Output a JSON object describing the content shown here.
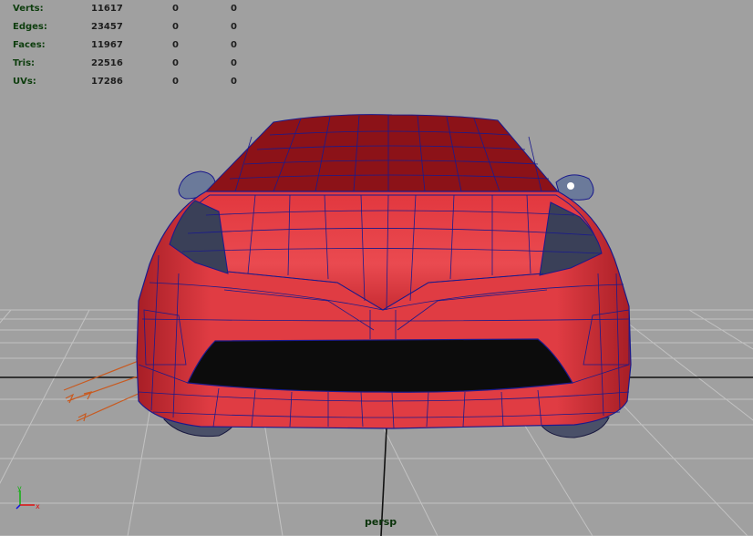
{
  "viewport": {
    "camera_label": "persp",
    "background_color": "#a0a0a0",
    "grid_color": "#c8c8c8",
    "axis_color": "#000000"
  },
  "heads_up_display": {
    "rows": [
      {
        "label": "Verts:",
        "values": [
          "11617",
          "0",
          "0"
        ]
      },
      {
        "label": "Edges:",
        "values": [
          "23457",
          "0",
          "0"
        ]
      },
      {
        "label": "Faces:",
        "values": [
          "11967",
          "0",
          "0"
        ]
      },
      {
        "label": "Tris:",
        "values": [
          "22516",
          "0",
          "0"
        ]
      },
      {
        "label": "UVs:",
        "values": [
          "17286",
          "0",
          "0"
        ]
      }
    ]
  },
  "axis_gizmo": {
    "labels": [
      "y",
      "x"
    ],
    "colors": {
      "x": "#e01010",
      "y": "#10b010",
      "z": "#1010e0"
    }
  },
  "model": {
    "type": "car front mesh",
    "body_color": "#e8434a",
    "wire_color": "#1a1a8c",
    "windshield_color": "#7a0f0f"
  }
}
